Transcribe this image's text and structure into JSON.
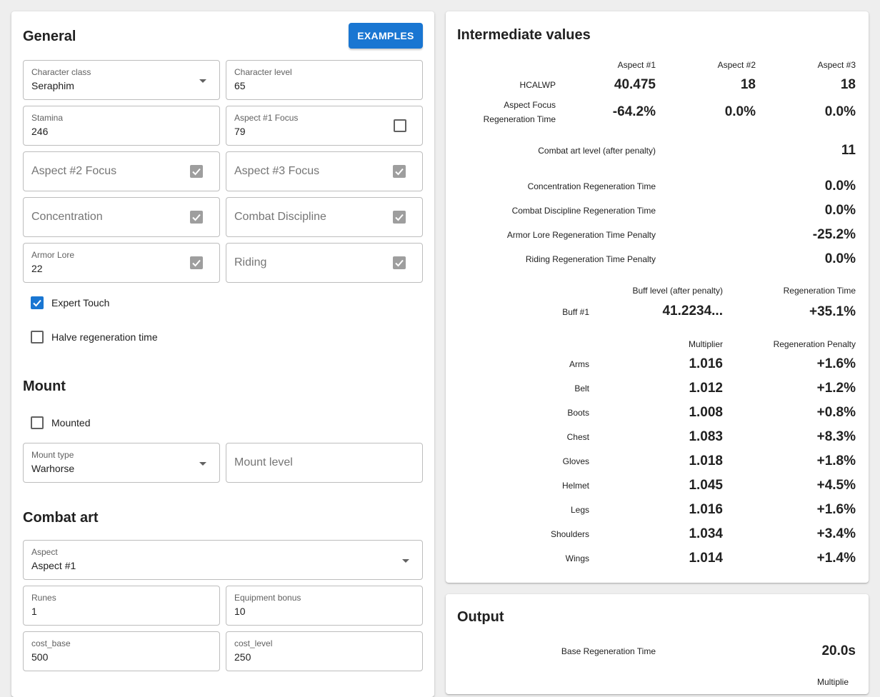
{
  "general": {
    "title": "General",
    "examples_button": "EXAMPLES",
    "character_class": {
      "label": "Character class",
      "value": "Seraphim"
    },
    "character_level": {
      "label": "Character level",
      "value": "65"
    },
    "stamina": {
      "label": "Stamina",
      "value": "246"
    },
    "aspect1_focus": {
      "label": "Aspect #1 Focus",
      "value": "79"
    },
    "aspect2_focus": {
      "placeholder": "Aspect #2 Focus"
    },
    "aspect3_focus": {
      "placeholder": "Aspect #3 Focus"
    },
    "concentration": {
      "placeholder": "Concentration"
    },
    "combat_discipline": {
      "placeholder": "Combat Discipline"
    },
    "armor_lore": {
      "label": "Armor Lore",
      "value": "22"
    },
    "riding": {
      "placeholder": "Riding"
    },
    "expert_touch": {
      "label": "Expert Touch",
      "checked": true
    },
    "halve_regeneration": {
      "label": "Halve regeneration time",
      "checked": false
    }
  },
  "mount": {
    "title": "Mount",
    "mounted": {
      "label": "Mounted",
      "checked": false
    },
    "mount_type": {
      "label": "Mount type",
      "value": "Warhorse"
    },
    "mount_level": {
      "placeholder": "Mount level"
    }
  },
  "combat_art": {
    "title": "Combat art",
    "aspect": {
      "label": "Aspect",
      "value": "Aspect #1"
    },
    "runes": {
      "label": "Runes",
      "value": "1"
    },
    "equipment_bonus": {
      "label": "Equipment bonus",
      "value": "10"
    },
    "cost_base": {
      "label": "cost_base",
      "value": "500"
    },
    "cost_level": {
      "label": "cost_level",
      "value": "250"
    }
  },
  "intermediate": {
    "title": "Intermediate values",
    "aspect_headers": [
      "Aspect #1",
      "Aspect #2",
      "Aspect #3"
    ],
    "hcalwp": {
      "label": "HCALWP",
      "values": [
        "40.475",
        "18",
        "18"
      ]
    },
    "aspect_focus_regen": {
      "label_line1": "Aspect Focus",
      "label_line2": "Regeneration Time",
      "values": [
        "-64.2%",
        "0.0%",
        "0.0%"
      ]
    },
    "combat_art_level": {
      "label": "Combat art level (after penalty)",
      "value": "11"
    },
    "concentration_regen": {
      "label": "Concentration Regeneration Time",
      "value": "0.0%"
    },
    "combat_discipline_regen": {
      "label": "Combat Discipline Regeneration Time",
      "value": "0.0%"
    },
    "armor_lore_penalty": {
      "label": "Armor Lore Regeneration Time Penalty",
      "value": "-25.2%"
    },
    "riding_penalty": {
      "label": "Riding Regeneration Time Penalty",
      "value": "0.0%"
    },
    "buff_header_level": "Buff level (after penalty)",
    "buff_header_regen": "Regeneration Time",
    "buff1": {
      "label": "Buff #1",
      "level": "41.2234...",
      "regen": "+35.1%"
    },
    "equip_header_multiplier": "Multiplier",
    "equip_header_penalty": "Regeneration Penalty",
    "equipment": [
      {
        "name": "Arms",
        "multiplier": "1.016",
        "penalty": "+1.6%"
      },
      {
        "name": "Belt",
        "multiplier": "1.012",
        "penalty": "+1.2%"
      },
      {
        "name": "Boots",
        "multiplier": "1.008",
        "penalty": "+0.8%"
      },
      {
        "name": "Chest",
        "multiplier": "1.083",
        "penalty": "+8.3%"
      },
      {
        "name": "Gloves",
        "multiplier": "1.018",
        "penalty": "+1.8%"
      },
      {
        "name": "Helmet",
        "multiplier": "1.045",
        "penalty": "+4.5%"
      },
      {
        "name": "Legs",
        "multiplier": "1.016",
        "penalty": "+1.6%"
      },
      {
        "name": "Shoulders",
        "multiplier": "1.034",
        "penalty": "+3.4%"
      },
      {
        "name": "Wings",
        "multiplier": "1.014",
        "penalty": "+1.4%"
      }
    ]
  },
  "output": {
    "title": "Output",
    "base_regen": {
      "label": "Base Regeneration Time",
      "value": "20.0s"
    },
    "partial_header": "Multiplie"
  }
}
